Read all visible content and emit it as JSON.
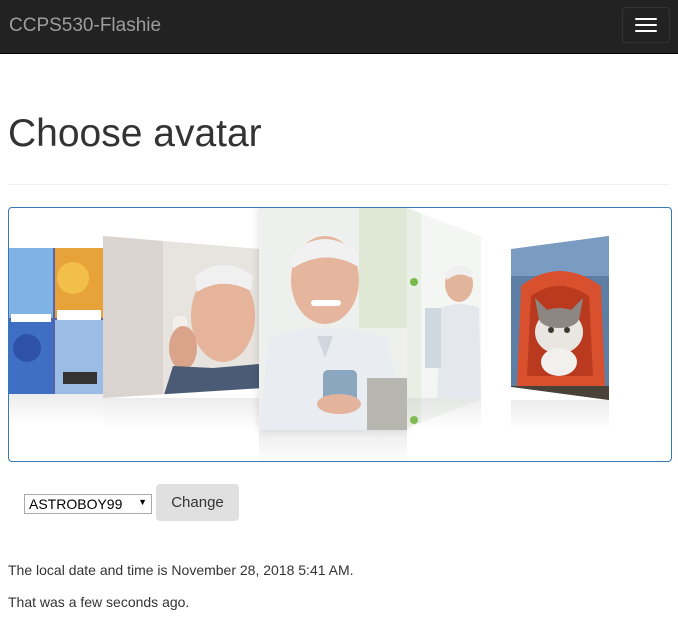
{
  "navbar": {
    "brand": "CCPS530-Flashie",
    "toggle_icon": "hamburger-menu-icon"
  },
  "page": {
    "title": "Choose avatar"
  },
  "coverflow": {
    "border_color": "#337ab7",
    "covers": [
      {
        "subject": "comic-strip",
        "icon": "comic-thumbnail-icon"
      },
      {
        "subject": "man-on-phone",
        "icon": "photo-thumbnail-icon"
      },
      {
        "subject": "man-with-mug",
        "icon": "photo-thumbnail-icon",
        "selected": true
      },
      {
        "subject": "man-at-office",
        "icon": "photo-thumbnail-icon"
      },
      {
        "subject": "cat-in-backpack",
        "icon": "photo-thumbnail-icon"
      }
    ]
  },
  "avatar_form": {
    "selected_value": "ASTROBOY99",
    "change_label": "Change"
  },
  "info": {
    "local_time": "The local date and time is November 28, 2018 5:41 AM.",
    "relative_time": "That was a few seconds ago."
  },
  "colors": {
    "navbar_bg": "#222222",
    "brand_text": "#9d9d9d",
    "button_bg": "#e0e0e0"
  }
}
